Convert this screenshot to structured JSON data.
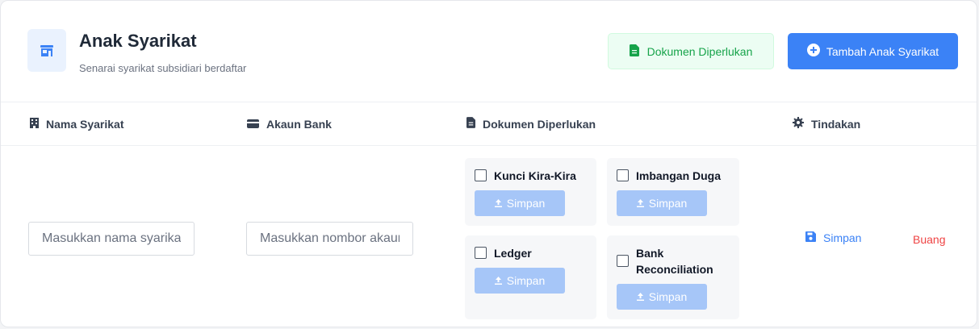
{
  "header": {
    "title": "Anak Syarikat",
    "subtitle": "Senarai syarikat subsidiari berdaftar",
    "logo_icon": "store-icon",
    "docs_button": "Dokumen Diperlukan",
    "docs_icon": "file-icon",
    "add_button": "Tambah Anak Syarikat",
    "add_icon": "plus-circle-icon"
  },
  "columns": {
    "name": "Nama Syarikat",
    "bank": "Akaun Bank",
    "docs": "Dokumen Diperlukan",
    "actions": "Tindakan"
  },
  "row": {
    "name_placeholder": "Masukkan nama syarikat",
    "bank_placeholder": "Masukkan nombor akaun bank",
    "documents": [
      {
        "label": "Kunci Kira-Kira",
        "checked": false,
        "button": "Simpan"
      },
      {
        "label": "Imbangan Duga",
        "checked": false,
        "button": "Simpan"
      },
      {
        "label": "Ledger",
        "checked": false,
        "button": "Simpan"
      },
      {
        "label": "Bank Reconciliation",
        "checked": false,
        "button": "Simpan"
      }
    ],
    "save_label": "Simpan",
    "delete_label": "Buang"
  },
  "colors": {
    "primary": "#3b82f6",
    "success": "#16a34a",
    "danger": "#ef4444",
    "disabled_button": "#a6c6f8"
  }
}
